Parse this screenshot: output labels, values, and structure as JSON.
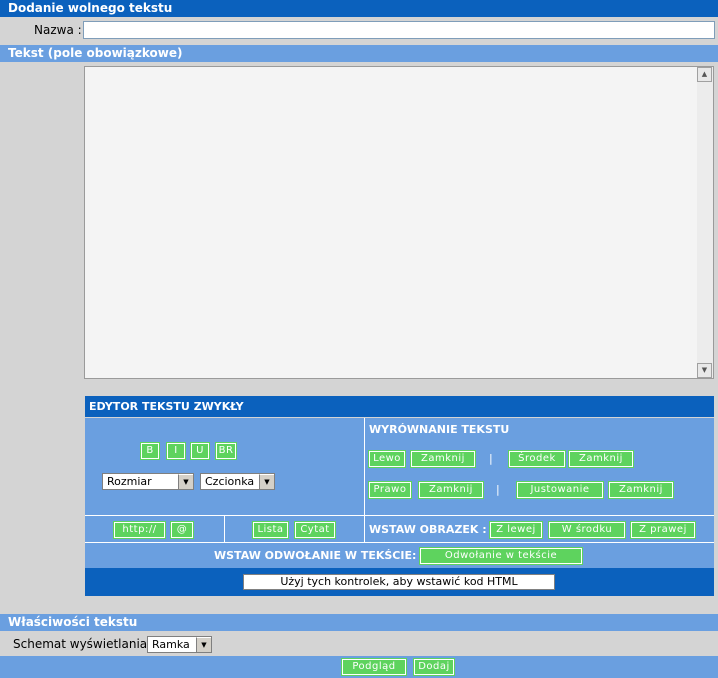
{
  "header": {
    "title": "Dodanie wolnego tekstu"
  },
  "name_field": {
    "label": "Nazwa :",
    "value": ""
  },
  "text_section": {
    "title": "Tekst (pole obowiązkowe)",
    "value": ""
  },
  "editor": {
    "title": "EDYTOR TEKSTU ZWYKŁY",
    "format_buttons": [
      "B",
      "I",
      "U",
      "BR"
    ],
    "size_select": "Rozmiar",
    "font_select": "Czcionka",
    "alignment": {
      "title": "WYRÓWNANIE TEKSTU",
      "row1": [
        "Lewo",
        "Zamknij",
        "|",
        "Środek",
        "Zamknij"
      ],
      "row2": [
        "Prawo",
        "Zamknij",
        "|",
        "Justowanie",
        "Zamknij"
      ]
    },
    "link_buttons": [
      "http://",
      "@"
    ],
    "list_buttons": [
      "Lista",
      "Cytat"
    ],
    "insert_image": {
      "label": "WSTAW OBRAZEK :",
      "buttons": [
        "Z lewej",
        "W środku",
        "Z prawej"
      ]
    },
    "insert_ref": {
      "label": "WSTAW ODWOŁANIE W TEKŚCIE:",
      "button": "Odwołanie w tekście"
    },
    "html_hint": "Użyj tych kontrolek, aby wstawić kod HTML"
  },
  "properties": {
    "title": "Właściwości tekstu",
    "schema_label": "Schemat wyświetlania :",
    "schema_value": "Ramka"
  },
  "footer": {
    "preview": "Podgląd",
    "add": "Dodaj"
  }
}
